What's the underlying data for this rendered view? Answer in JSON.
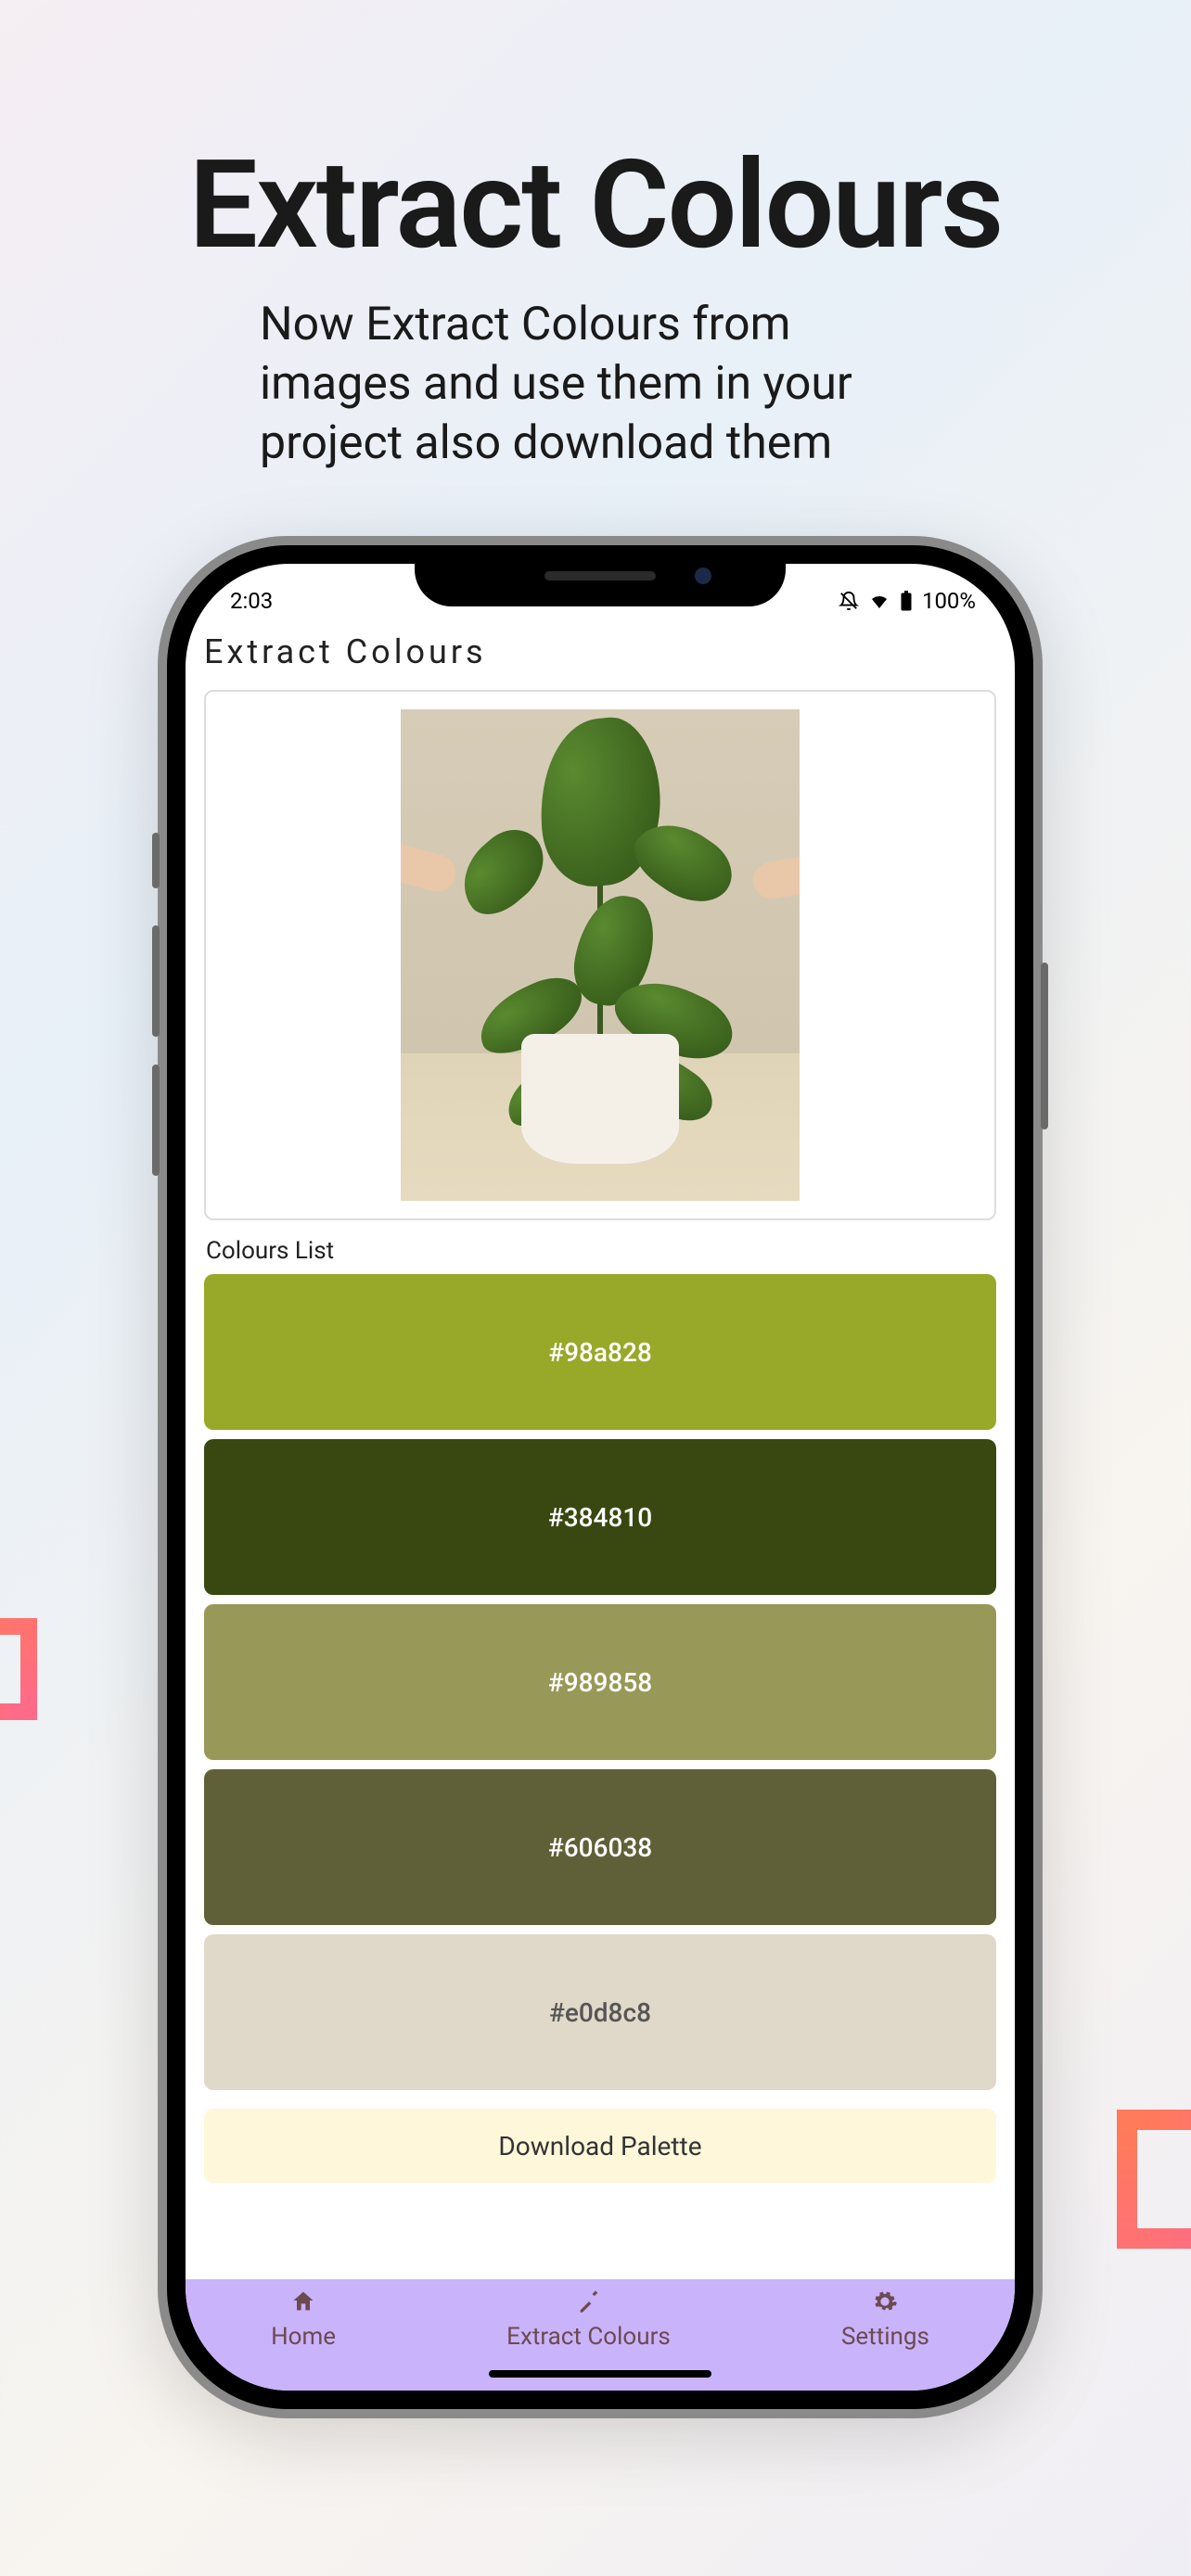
{
  "promo": {
    "title": "Extract Colours",
    "subtitle": "Now Extract Colours from images and use them in your project also download them"
  },
  "status": {
    "time": "2:03",
    "battery": "100%"
  },
  "app": {
    "title": "Extract Colours",
    "list_heading": "Colours List",
    "swatches": [
      {
        "hex": "#98a828",
        "text_color": "#ffffff"
      },
      {
        "hex": "#384810",
        "text_color": "#ffffff"
      },
      {
        "hex": "#989858",
        "text_color": "#ffffff"
      },
      {
        "hex": "#606038",
        "text_color": "#ffffff"
      },
      {
        "hex": "#e0d8c8",
        "text_color": "#555555"
      }
    ],
    "download_label": "Download Palette"
  },
  "nav": {
    "home": "Home",
    "extract": "Extract Colours",
    "settings": "Settings"
  }
}
